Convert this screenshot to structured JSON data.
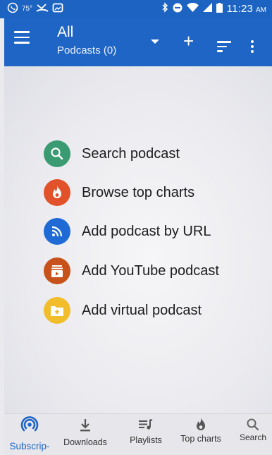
{
  "status_bar": {
    "temperature": "75°",
    "time": "11:23",
    "ampm": "AM",
    "icons": [
      "whatsapp-icon",
      "missed-call-icon",
      "gallery-icon",
      "bluetooth-icon",
      "do-not-disturb-icon",
      "wifi-icon",
      "signal-icon",
      "battery-icon"
    ]
  },
  "header": {
    "title": "All",
    "subtitle": "Podcasts (0)"
  },
  "actions": [
    {
      "label": "Search podcast",
      "icon": "search-icon",
      "color": "#3a9b72"
    },
    {
      "label": "Browse top charts",
      "icon": "flame-icon",
      "color": "#e2522a"
    },
    {
      "label": "Add podcast by URL",
      "icon": "rss-icon",
      "color": "#1f6ad4"
    },
    {
      "label": "Add YouTube podcast",
      "icon": "youtube-icon",
      "color": "#c8521c"
    },
    {
      "label": "Add virtual podcast",
      "icon": "folder-add-icon",
      "color": "#f1bd2b"
    }
  ],
  "bottom_nav": {
    "items": [
      {
        "label": "Subscrip-",
        "icon": "podcast-icon",
        "active": true
      },
      {
        "label": "Downloads",
        "icon": "download-icon",
        "active": false
      },
      {
        "label": "Playlists",
        "icon": "playlist-icon",
        "active": false
      },
      {
        "label": "Top charts",
        "icon": "flame-icon",
        "active": false
      },
      {
        "label": "Search",
        "icon": "search-icon",
        "active": false
      }
    ]
  },
  "colors": {
    "primary": "#1f65c6",
    "active_nav": "#1f65c6"
  }
}
